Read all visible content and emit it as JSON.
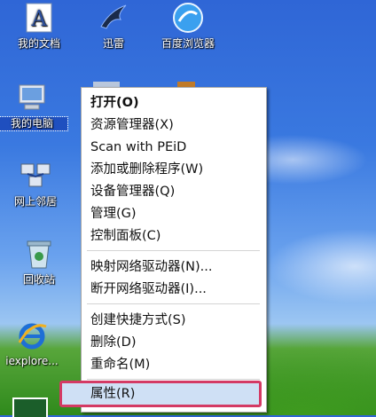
{
  "desktop_icons": {
    "my_documents": "我的文档",
    "thunder": "迅雷",
    "baidu_browser": "百度浏览器",
    "my_computer": "我的电脑",
    "network": "网上邻居",
    "recycle_bin": "回收站",
    "iexplore": "iexplore..."
  },
  "context_menu": {
    "open": "打开(O)",
    "explorer": "资源管理器(X)",
    "scan_peid": "Scan with PEiD",
    "add_remove": "添加或删除程序(W)",
    "device_manager": "设备管理器(Q)",
    "manage": "管理(G)",
    "control_panel": "控制面板(C)",
    "map_drive": "映射网络驱动器(N)...",
    "disconnect_drive": "断开网络驱动器(I)...",
    "create_shortcut": "创建快捷方式(S)",
    "delete": "删除(D)",
    "rename": "重命名(M)",
    "properties": "属性(R)"
  },
  "colors": {
    "highlight_border": "#d43a64",
    "selection": "#1f4fbf"
  }
}
